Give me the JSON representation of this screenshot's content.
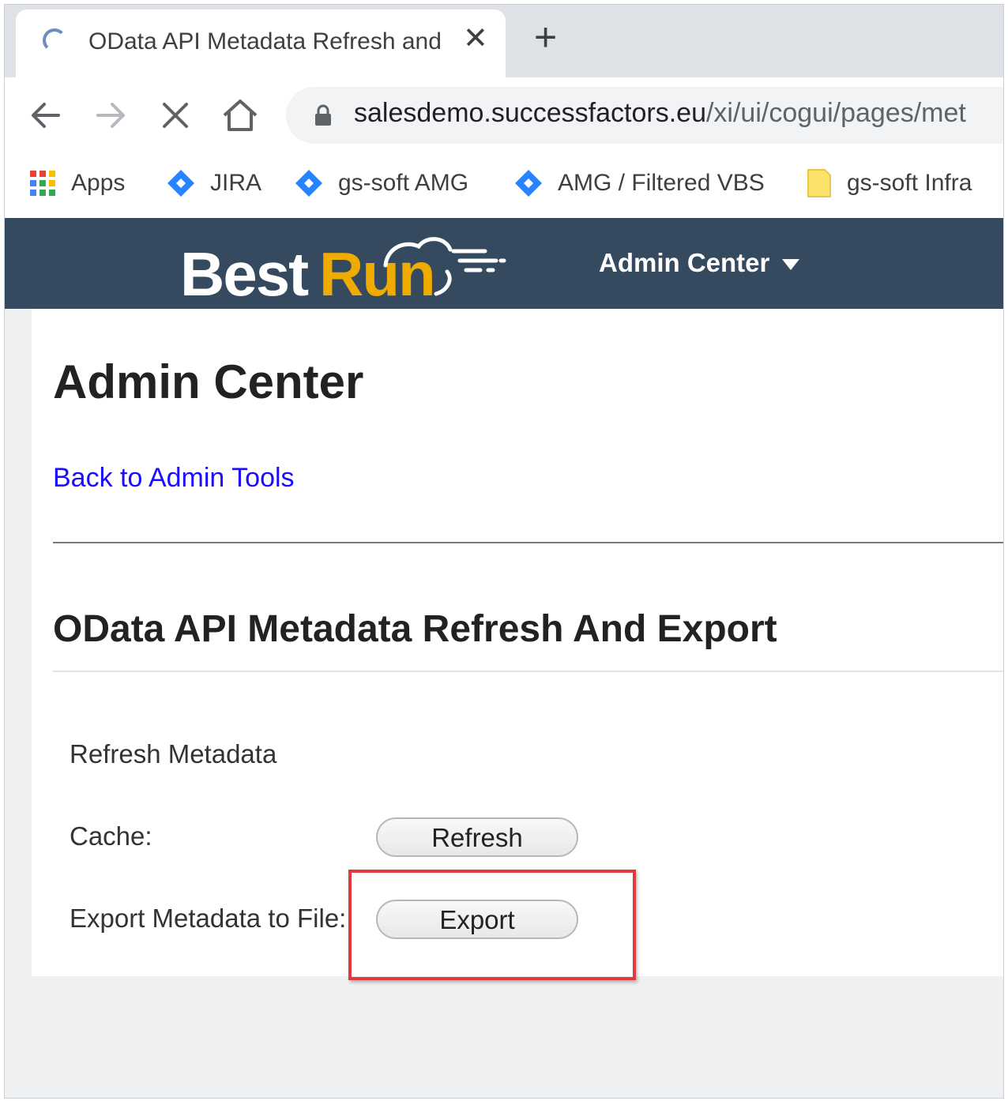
{
  "browser": {
    "tab_title": "OData API Metadata Refresh and",
    "url_host": "salesdemo.successfactors.eu",
    "url_path": "/xi/ui/cogui/pages/met"
  },
  "bookmarks": [
    {
      "label": "Apps",
      "icon": "apps-grid-icon"
    },
    {
      "label": "JIRA",
      "icon": "jira-icon"
    },
    {
      "label": "gs-soft AMG",
      "icon": "jira-icon"
    },
    {
      "label": "AMG / Filtered VBS",
      "icon": "jira-icon"
    },
    {
      "label": "gs-soft Infra",
      "icon": "folder-icon"
    }
  ],
  "header": {
    "logo_best": "Best",
    "logo_run": "Run",
    "menu_label": "Admin Center",
    "bg_color": "#354a5f",
    "accent_color": "#f0ab00"
  },
  "page": {
    "title": "Admin Center",
    "back_link": "Back to Admin Tools",
    "section_title": "OData API Metadata Refresh And Export",
    "subsection": "Refresh Metadata",
    "cache_label": "Cache:",
    "refresh_button": "Refresh",
    "export_label": "Export Metadata to File:",
    "export_button": "Export"
  },
  "annotation": {
    "highlight_color": "#e03a3e",
    "target": "export-button"
  }
}
